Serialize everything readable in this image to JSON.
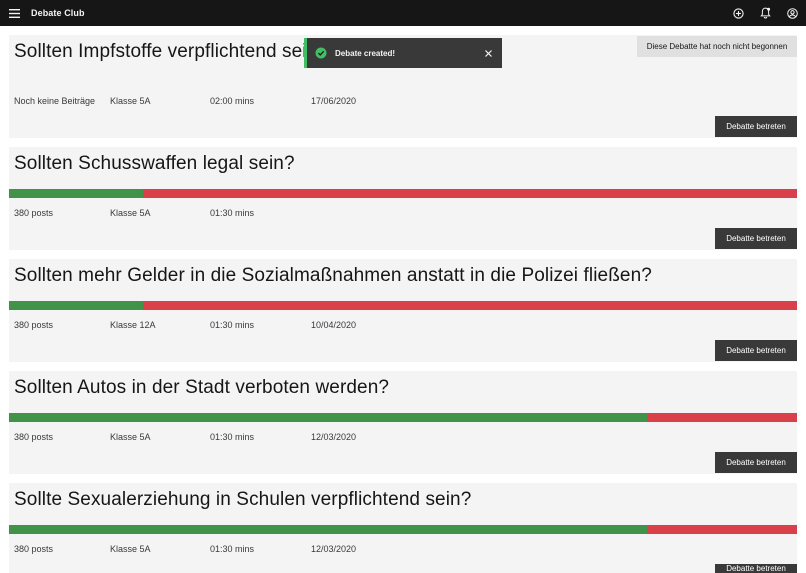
{
  "app": {
    "title": "Debate Club",
    "icons": [
      "menu-icon",
      "add-icon",
      "notification-icon",
      "user-avatar-icon"
    ]
  },
  "toast": {
    "message": "Debate created!",
    "kind": "success",
    "accent": "#42be65"
  },
  "colors": {
    "header_bg": "#161616",
    "card_bg": "#f4f4f4",
    "button_bg": "#393939",
    "pro": "#42934a",
    "contra": "#d9404a"
  },
  "debates": [
    {
      "title": "Sollten Impfstoffe verpflichtend sein?",
      "posts": "Noch keine Beiträge",
      "class": "Klasse 5A",
      "duration": "02:00 mins",
      "date": "17/06/2020",
      "status": "Diese Debatte hat noch nicht begonnen",
      "button": "Debatte betreten"
    },
    {
      "title": "Sollten Schusswaffen legal sein?",
      "pro_fraction": 0.17,
      "posts": "380 posts",
      "class": "Klasse 5A",
      "duration": "01:30 mins",
      "date": "",
      "button": "Debatte betreten"
    },
    {
      "title": "Sollten mehr Gelder in die Sozialmaßnahmen anstatt in die Polizei fließen?",
      "pro_fraction": 0.17,
      "posts": "380 posts",
      "class": "Klasse 12A",
      "duration": "01:30 mins",
      "date": "10/04/2020",
      "button": "Debatte betreten"
    },
    {
      "title": "Sollten Autos in der Stadt verboten werden?",
      "pro_fraction": 0.81,
      "posts": "380 posts",
      "class": "Klasse 5A",
      "duration": "01:30 mins",
      "date": "12/03/2020",
      "button": "Debatte betreten"
    },
    {
      "title": "Sollte Sexualerziehung in Schulen verpflichtend sein?",
      "pro_fraction": 0.81,
      "posts": "380 posts",
      "class": "Klasse 5A",
      "duration": "01:30 mins",
      "date": "12/03/2020",
      "button": "Debatte betreten"
    }
  ]
}
